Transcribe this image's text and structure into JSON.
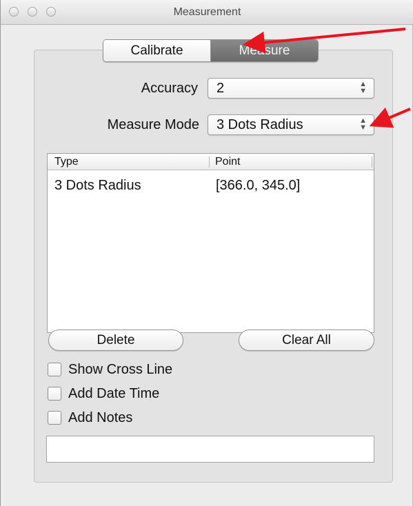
{
  "window": {
    "title": "Measurement"
  },
  "tabs": [
    {
      "label": "Calibrate",
      "selected": false
    },
    {
      "label": "Measure",
      "selected": true
    }
  ],
  "accuracy": {
    "label": "Accuracy",
    "value": "2"
  },
  "measure_mode": {
    "label": "Measure Mode",
    "value": "3 Dots Radius"
  },
  "table": {
    "columns": [
      "Type",
      "Point"
    ],
    "rows": [
      {
        "type": "3 Dots Radius",
        "point": "[366.0, 345.0]"
      }
    ]
  },
  "buttons": {
    "delete": "Delete",
    "clear_all": "Clear All"
  },
  "checkboxes": [
    {
      "label": "Show Cross Line",
      "checked": false
    },
    {
      "label": "Add Date Time",
      "checked": false
    },
    {
      "label": "Add Notes",
      "checked": false
    }
  ],
  "notes_input": {
    "value": ""
  },
  "colors": {
    "annotation_arrow": "#e8141e",
    "selected_tab": "#7a7a7a"
  }
}
